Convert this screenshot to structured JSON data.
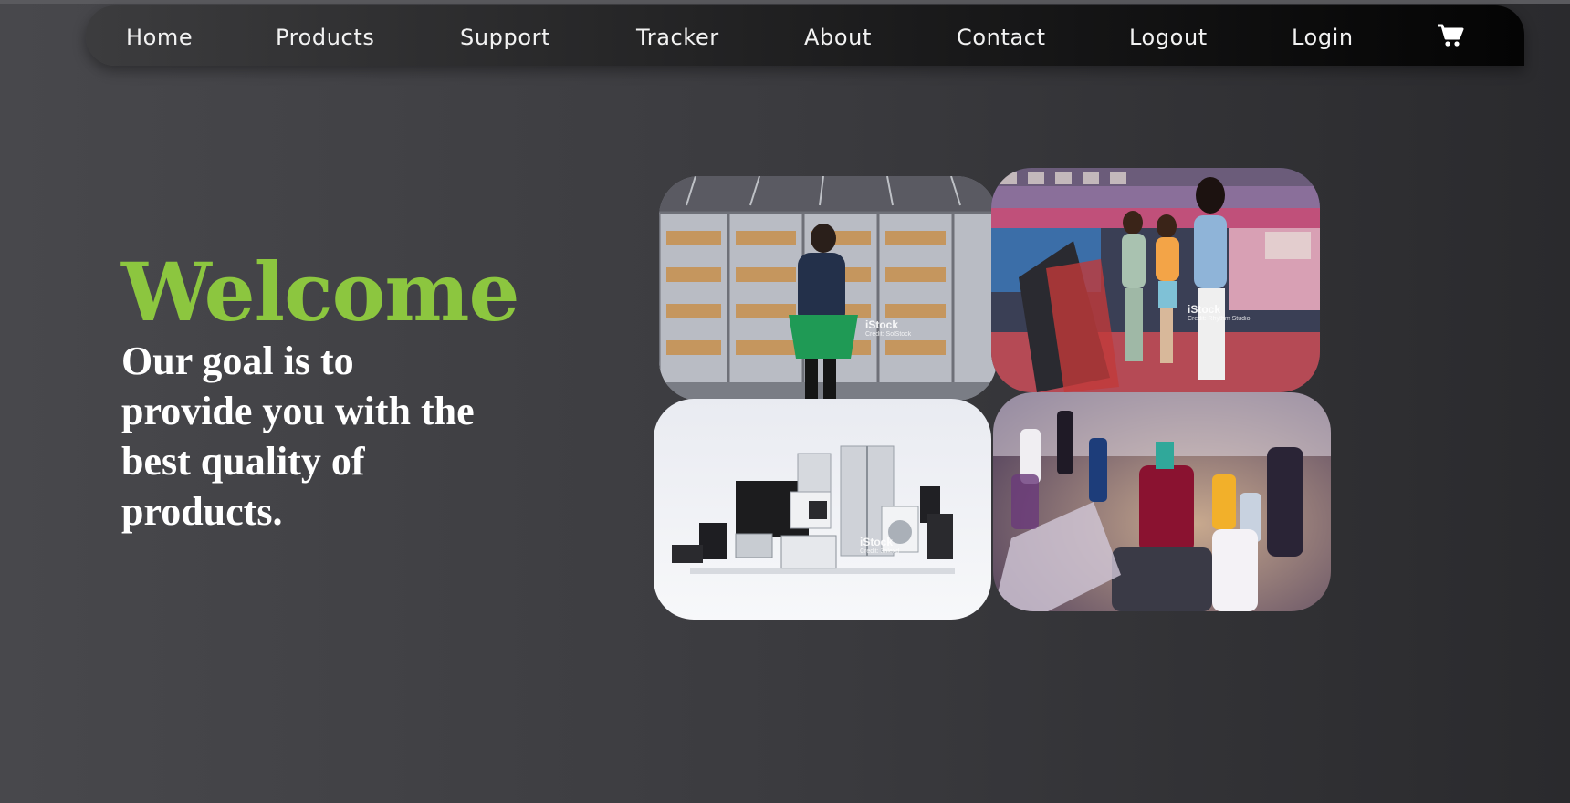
{
  "nav": {
    "items": [
      {
        "label": "Home",
        "name": "home"
      },
      {
        "label": "Products",
        "name": "products"
      },
      {
        "label": "Support",
        "name": "support"
      },
      {
        "label": "Tracker",
        "name": "tracker"
      },
      {
        "label": "About",
        "name": "about"
      },
      {
        "label": "Contact",
        "name": "contact"
      },
      {
        "label": "Logout",
        "name": "logout"
      },
      {
        "label": "Login",
        "name": "login"
      }
    ],
    "cart_icon": "shopping-cart-icon"
  },
  "hero": {
    "title": "Welcome",
    "subtitle": "Our goal is to provide you with the best quality of products."
  },
  "gallery": {
    "images": [
      {
        "name": "grocery-freezer-photo",
        "watermark": "iStock",
        "credit": "Credit: SolStock"
      },
      {
        "name": "stationery-store-photo",
        "watermark": "iStock",
        "credit": "Credit: Rhythm Studio"
      },
      {
        "name": "home-appliances-photo",
        "watermark": "iStock",
        "credit": "Credit: 3alexd"
      },
      {
        "name": "vape-products-photo",
        "watermark": "",
        "credit": ""
      }
    ]
  },
  "colors": {
    "accent_green": "#8cc63f",
    "nav_text": "#f2f2f2",
    "background": "#3b3b3f"
  }
}
